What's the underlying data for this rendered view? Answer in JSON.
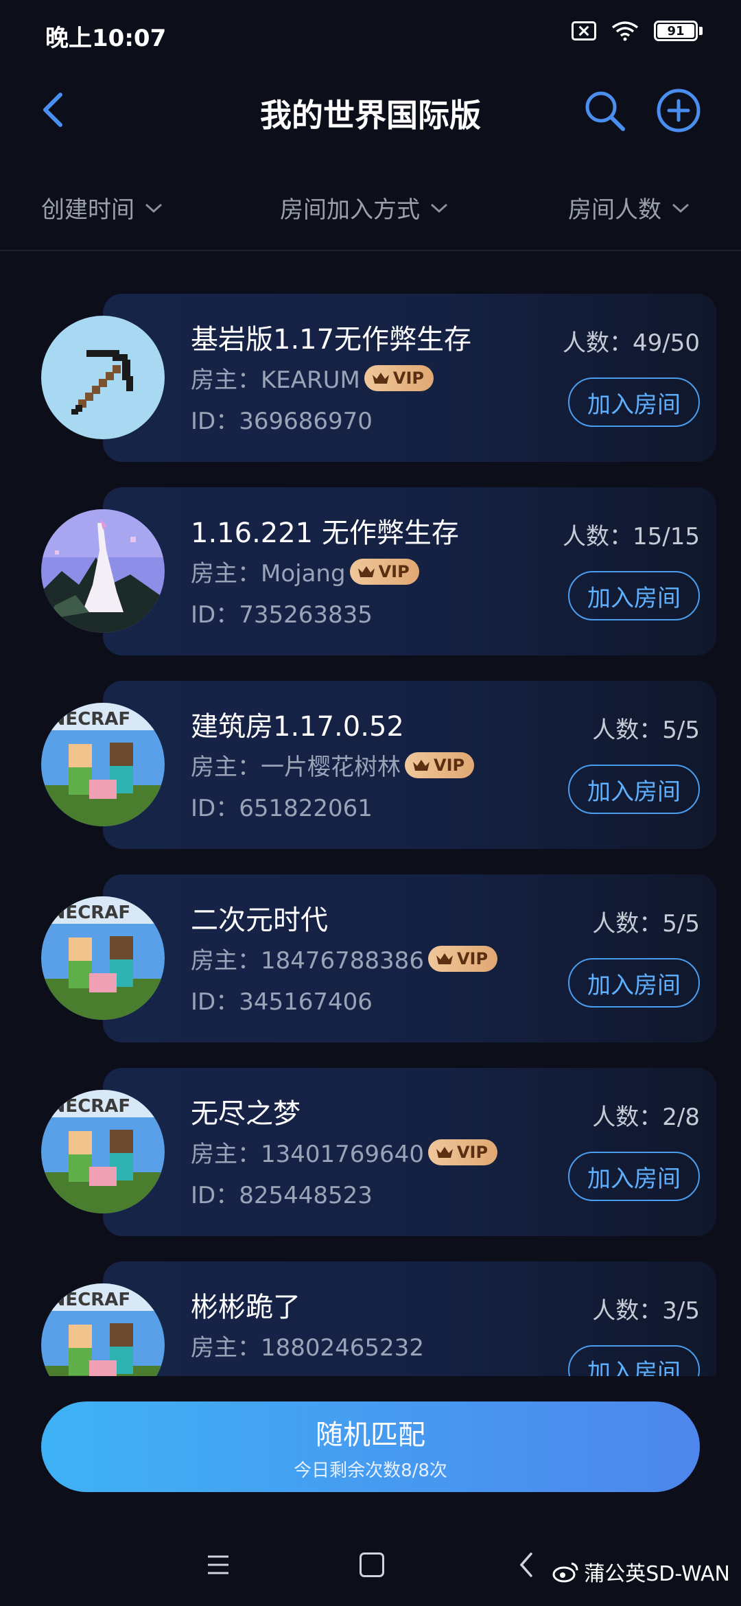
{
  "status": {
    "time": "晚上10:07",
    "battery": "91"
  },
  "header": {
    "title": "我的世界国际版"
  },
  "filters": [
    {
      "label": "创建时间"
    },
    {
      "label": "房间加入方式"
    },
    {
      "label": "房间人数"
    }
  ],
  "rooms": [
    {
      "name": "基岩版1.17无作弊生存",
      "owner": "房主：KEARUM",
      "vip": "VIP",
      "id": "ID：369686970",
      "count": "人数：49/50",
      "join": "加入房间",
      "avatar": "pickaxe"
    },
    {
      "name": "1.16.221 无作弊生存",
      "owner": "房主：Mojang",
      "vip": "VIP",
      "id": "ID：735263835",
      "count": "人数：15/15",
      "join": "加入房间",
      "avatar": "landscape"
    },
    {
      "name": "建筑房1.17.0.52",
      "owner": "房主：一片樱花树林",
      "vip": "VIP",
      "id": "ID：651822061",
      "count": "人数：5/5",
      "join": "加入房间",
      "avatar": "minecraft"
    },
    {
      "name": "二次元时代",
      "owner": "房主：18476788386",
      "vip": "VIP",
      "id": "ID：345167406",
      "count": "人数：5/5",
      "join": "加入房间",
      "avatar": "minecraft"
    },
    {
      "name": "无尽之梦",
      "owner": "房主：13401769640",
      "vip": "VIP",
      "id": "ID：825448523",
      "count": "人数：2/8",
      "join": "加入房间",
      "avatar": "minecraft"
    },
    {
      "name": "彬彬跪了",
      "owner": "房主：18802465232",
      "vip": "",
      "id": "",
      "count": "人数：3/5",
      "join": "加入房间",
      "avatar": "minecraft"
    }
  ],
  "match": {
    "title": "随机匹配",
    "subtitle": "今日剩余次数8/8次"
  },
  "watermark": {
    "text": "蒲公英SD-WAN"
  },
  "avatar_text": "INECRAF"
}
